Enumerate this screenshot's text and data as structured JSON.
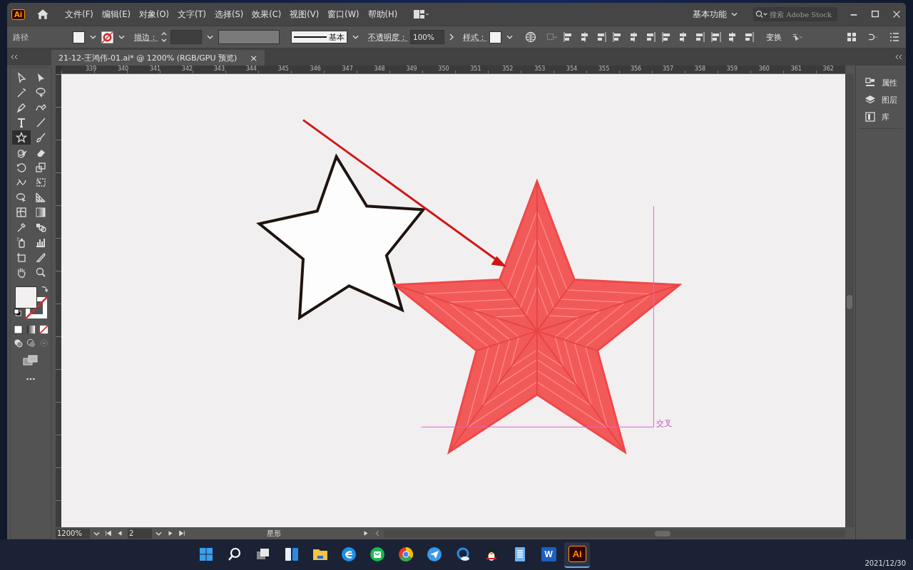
{
  "menubar": {
    "logo": "Ai",
    "menus": [
      "文件(F)",
      "编辑(E)",
      "对象(O)",
      "文字(T)",
      "选择(S)",
      "效果(C)",
      "视图(V)",
      "窗口(W)",
      "帮助(H)"
    ],
    "workspace": "基本功能",
    "search": {
      "placeholder": "搜索 Adobe Stock"
    }
  },
  "control_bar": {
    "selection": "路径",
    "stroke_label": "描边：",
    "profile": "基本",
    "opacity_label": "不透明度：",
    "opacity": "100%",
    "style_label": "样式：",
    "transform": "变换"
  },
  "document_tab": {
    "title": "21-12-王鸿伟-01.ai* @ 1200% (RGB/GPU 预览)",
    "close": "×"
  },
  "ruler": {
    "labels": [
      "339",
      "340",
      "341",
      "342",
      "343",
      "344",
      "345",
      "346",
      "347",
      "348",
      "349",
      "350",
      "351",
      "352",
      "353",
      "354",
      "355",
      "356",
      "357",
      "358",
      "359",
      "360",
      "361",
      "362"
    ]
  },
  "tools": [
    {
      "kind": "selection",
      "selected": false
    },
    {
      "kind": "direct-selection",
      "selected": false
    },
    {
      "kind": "magic-wand",
      "selected": false
    },
    {
      "kind": "lasso",
      "selected": false
    },
    {
      "kind": "pen",
      "selected": false
    },
    {
      "kind": "curvature",
      "selected": false
    },
    {
      "kind": "type",
      "selected": false
    },
    {
      "kind": "line",
      "selected": false
    },
    {
      "kind": "star",
      "selected": true
    },
    {
      "kind": "paintbrush",
      "selected": false
    },
    {
      "kind": "shaper",
      "selected": false
    },
    {
      "kind": "eraser",
      "selected": false
    },
    {
      "kind": "rotate",
      "selected": false
    },
    {
      "kind": "scale",
      "selected": false
    },
    {
      "kind": "warp",
      "selected": false
    },
    {
      "kind": "free-transform",
      "selected": false
    },
    {
      "kind": "shape-builder",
      "selected": false
    },
    {
      "kind": "perspective",
      "selected": false
    },
    {
      "kind": "mesh",
      "selected": false
    },
    {
      "kind": "gradient",
      "selected": false
    },
    {
      "kind": "eyedropper",
      "selected": false
    },
    {
      "kind": "blend",
      "selected": false
    },
    {
      "kind": "symbol-sprayer",
      "selected": false
    },
    {
      "kind": "graph",
      "selected": false
    },
    {
      "kind": "artboard",
      "selected": false
    },
    {
      "kind": "slice",
      "selected": false
    },
    {
      "kind": "hand",
      "selected": false
    },
    {
      "kind": "zoom",
      "selected": false
    }
  ],
  "canvas": {
    "guide_label": "交叉"
  },
  "right_panel": {
    "items": [
      {
        "kind": "properties",
        "label": "属性"
      },
      {
        "kind": "layers",
        "label": "图层"
      },
      {
        "kind": "libraries",
        "label": "库"
      }
    ]
  },
  "status_bar": {
    "zoom": "1200%",
    "artboard": "2",
    "tool": "星形"
  },
  "taskbar": {
    "items": [
      {
        "kind": "start",
        "selected": false
      },
      {
        "kind": "search",
        "selected": false
      },
      {
        "kind": "task-view",
        "selected": false
      },
      {
        "kind": "widgets",
        "selected": false
      },
      {
        "kind": "folder",
        "selected": false
      },
      {
        "kind": "edge",
        "selected": false
      },
      {
        "kind": "bag",
        "selected": false
      },
      {
        "kind": "chrome",
        "selected": false
      },
      {
        "kind": "bird",
        "selected": false
      },
      {
        "kind": "browser",
        "selected": false
      },
      {
        "kind": "penguin",
        "selected": false
      },
      {
        "kind": "notepad",
        "selected": false
      },
      {
        "kind": "word",
        "label": "W",
        "selected": false
      },
      {
        "kind": "illustrator",
        "label": "Ai",
        "selected": true
      }
    ],
    "date": "2021/12/30"
  }
}
